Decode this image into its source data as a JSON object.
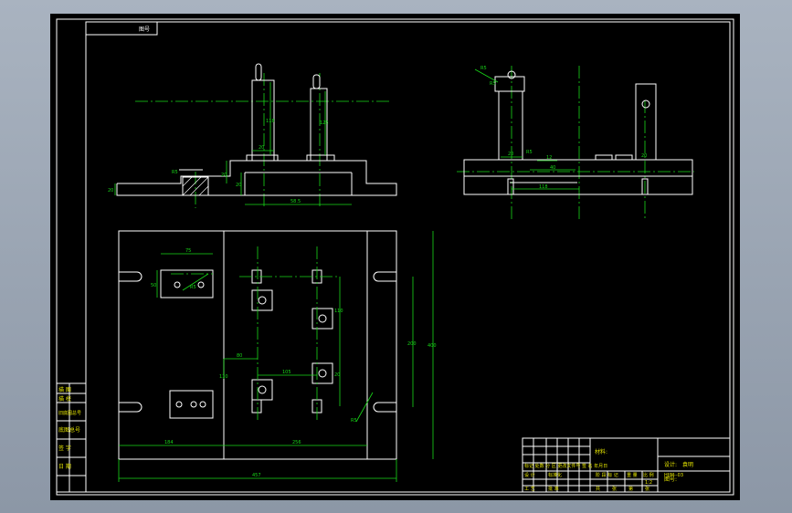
{
  "colors": {
    "background": "#8c97a6",
    "sheet": "#000000",
    "outline": "#ffffff",
    "dimension": "#18d818",
    "title_text": "#e8e800"
  },
  "title_label": "图号",
  "title_block": {
    "material_label": "材料:",
    "designer_label": "设计:",
    "designer_name": "袁明",
    "drawing_no_label": "图号:",
    "drawing_no": "HJJM--03",
    "cells": [
      "标记 处数 分 区 更改文件号 签 名 年月日",
      "设 计",
      "工 艺",
      "标准化",
      "批 准",
      "阶 段 标 记",
      "重 量",
      "比 例",
      "1:2",
      "共",
      "张",
      "第",
      "张"
    ]
  },
  "side_block": [
    "描 图",
    "描 校",
    "旧底图总号",
    "底图总号",
    "签 字",
    "日 期"
  ],
  "dimensions": {
    "front": [
      "20",
      "R5",
      "20",
      "20",
      "20",
      "118",
      "125",
      "58.5"
    ],
    "side": [
      "R5",
      "R5",
      "20",
      "R5",
      "12",
      "20",
      "40",
      "118"
    ],
    "plan": [
      "75",
      "50",
      "R5",
      "R5",
      "80",
      "110",
      "105",
      "110",
      "20",
      "200",
      "400",
      "R5",
      "184",
      "256",
      "457"
    ]
  }
}
